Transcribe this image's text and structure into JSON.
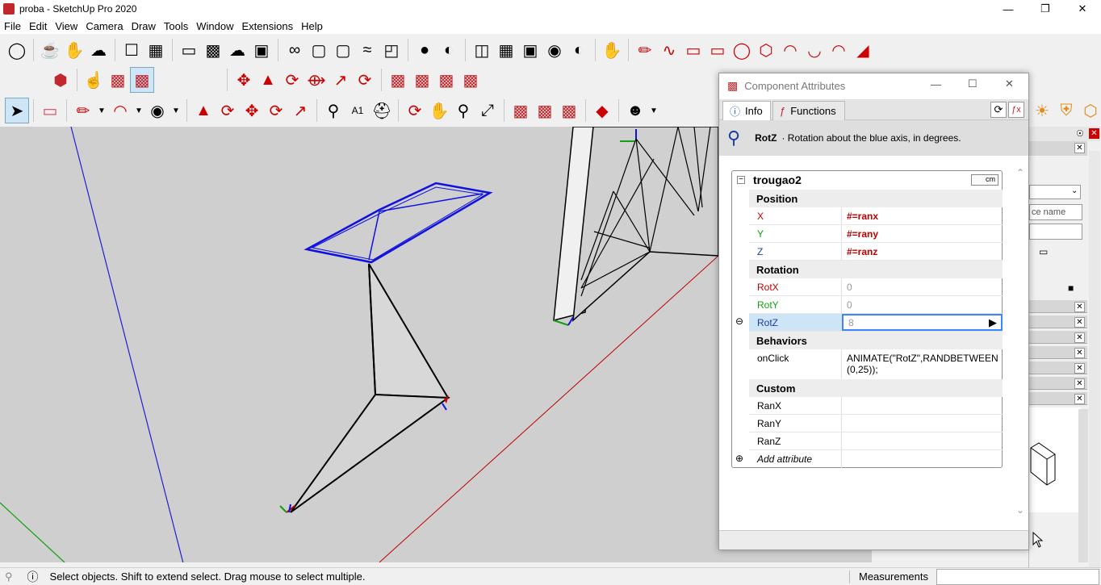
{
  "app": {
    "title": "proba - SketchUp Pro 2020"
  },
  "menu": [
    "File",
    "Edit",
    "View",
    "Camera",
    "Draw",
    "Tools",
    "Window",
    "Extensions",
    "Help"
  ],
  "dialog": {
    "title": "Component Attributes",
    "tabs": {
      "info": "Info",
      "functions": "Functions"
    },
    "description": {
      "attr": "RotZ",
      "text": "· Rotation about the blue axis, in degrees."
    },
    "component_name": "trougao2",
    "units_label": "cm",
    "sections": {
      "position": "Position",
      "rotation": "Rotation",
      "behaviors": "Behaviors",
      "custom": "Custom"
    },
    "rows": {
      "x": {
        "key": "X",
        "value": "#=ranx"
      },
      "y": {
        "key": "Y",
        "value": "#=rany"
      },
      "z": {
        "key": "Z",
        "value": "#=ranz"
      },
      "rotx": {
        "key": "RotX",
        "value": "0"
      },
      "roty": {
        "key": "RotY",
        "value": "0"
      },
      "rotz": {
        "key": "RotZ",
        "value": "8"
      },
      "onclick": {
        "key": "onClick",
        "value": "ANIMATE(\"RotZ\",RANDBETWEEN(0,25));"
      },
      "ranx": {
        "key": "RanX",
        "value": ""
      },
      "rany": {
        "key": "RanY",
        "value": ""
      },
      "ranz": {
        "key": "RanZ",
        "value": ""
      }
    },
    "add_attribute": "Add attribute"
  },
  "right_panel": {
    "name_placeholder": "ce name"
  },
  "status": {
    "message": "Select objects. Shift to extend select. Drag mouse to select multiple.",
    "measurements_label": "Measurements",
    "measurements_value": ""
  },
  "colors": {
    "axis_x": "#c00000",
    "axis_y": "#10a010",
    "axis_z": "#0000c8",
    "selection": "#1010e0",
    "highlight": "#3a86ff"
  }
}
